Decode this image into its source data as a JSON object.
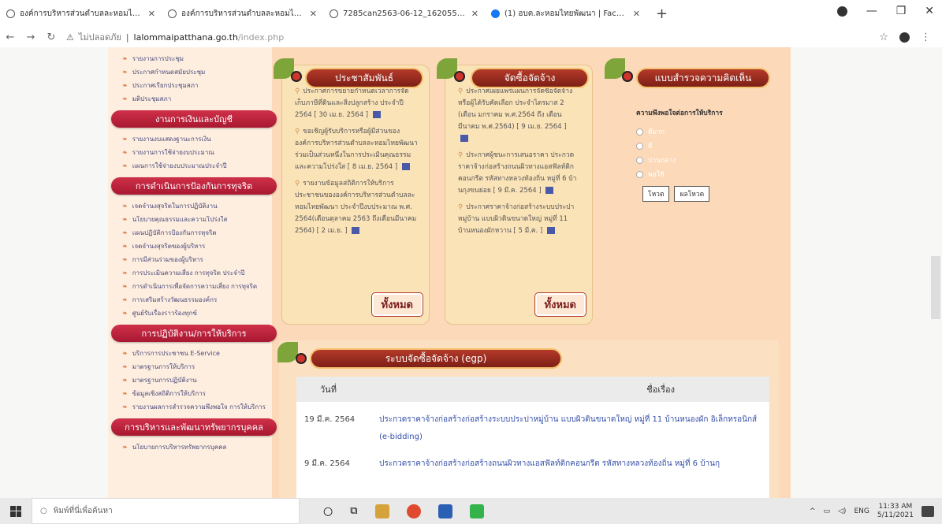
{
  "browser": {
    "tabs": [
      {
        "title": "องค์การบริหารส่วนตำบลละหอมไทยพัฒนา",
        "icon": "globe-icon"
      },
      {
        "title": "องค์การบริหารส่วนตำบลละหอมไทยพัฒนา",
        "icon": "globe-icon"
      },
      {
        "title": "7285can2563-06-12_162055pk",
        "icon": "globe-icon"
      },
      {
        "title": "(1) อบต.ละหอมไทยพัฒนา | Facebook",
        "icon": "facebook-icon"
      }
    ],
    "new_tab": "+",
    "url_secure_label": "ไม่ปลอดภัย",
    "url_domain": "lalommaipatthana.go.th",
    "url_path": "/index.php"
  },
  "sidebar": {
    "items_top": [
      "รายงานการประชุม",
      "ประกาศกำหนดสมัยประชุม",
      "ประกาศเรียกประชุมสภา",
      "มติประชุมสภา"
    ],
    "head_finance": "งานการเงินและบัญชี",
    "items_finance": [
      "รายงานงบแสดงฐานะการเงิน",
      "รายงานการใช้จ่ายงบประมาณ",
      "แผนการใช้จ่ายงบประมาณประจำปี"
    ],
    "head_corruption": "การดำเนินการป้องกันการทุจริต",
    "items_corruption": [
      "เจตจำนงสุจริตในการปฏิบัติงาน",
      "นโยบายคุณธรรมและความโปร่งใส",
      "แผนปฏิบัติการป้องกันการทุจริต",
      "เจตจำนงสุจริตของผู้บริหาร",
      "การมีส่วนร่วมของผู้บริหาร",
      "การประเมินความเสี่ยง การทุจริต ประจำปี",
      "การดำเนินการเพื่อจัดการความเสี่ยง การทุจริต",
      "การเสริมสร้างวัฒนธรรมองค์กร",
      "ศูนย์รับเรื่องราวร้องทุกข์"
    ],
    "head_service": "การปฏิบัติงาน/การให้บริการ",
    "items_service": [
      "บริการการประชาชน E-Service",
      "มาตรฐานการให้บริการ",
      "มาตรฐานการปฏิบัติงาน",
      "ข้อมูลเชิงสถิติการให้บริการ",
      "รายงานผลการสำรวจความพึงพอใจ การให้บริการ"
    ],
    "head_hr": "การบริหารและพัฒนาทรัพยากรบุคคล",
    "items_hr": [
      "นโยบายการบริหารทรัพยากรบุคคล"
    ]
  },
  "pr_box": {
    "title": "ประชาสัมพันธ์",
    "news": [
      "ประกาศการขยายกำหนดเวลาการจัดเก็บภาษีที่ดินและสิ่งปลูกสร้าง ประจำปี 2564 [ 30 เม.ย. 2564 ]",
      "ขอเชิญผู้รับบริการหรือผู้มีส่วนของ องค์การบริหารส่วนตำบลละหอมไทยพัฒนา ร่วมเป็นส่วนหนึ่งในการประเมินคุณธรรมและความโปร่งใส [ 8 เม.ย. 2564 ]",
      "รายงานข้อมูลสถิติการให้บริการประชาชนขององค์การบริหารส่วนตำบลละหอมไทยพัฒนา ประจำปีงบประมาณ พ.ศ. 2564(เดือนตุลาคม 2563 ถึงเดือนมีนาคม 2564) [ 2 เม.ย. ]"
    ],
    "all_label": "ทั้งหมด"
  },
  "procure_box": {
    "title": "จัดซื้อจัดจ้าง",
    "news": [
      "ประกาศเผยแพร่แผนการจัดซื้อจัดจ้างหรือผู้ได้รับคัดเลือก ประจำไตรมาส 2 (เดือน มกราคม พ.ศ.2564 ถึง เดือนมีนาคม พ.ศ.2564) [ 9 เม.ย. 2564 ]",
      "ประกาศผู้ชนะการเสนอราคา ประกวดราคาจ้างก่อสร้างถนนผิวทางแอสฟัลท์ติกคอนกรีต รหัสทางหลวงท้องถิ่น หมู่ที่ 6 บ้านกุงขนย่อย [ 9 มี.ค. 2564 ]",
      "ประกาศราคาจ้างก่อสร้างระบบประปาหมู่บ้าน แบบผิวดินขนาดใหญ่ หมู่ที่ 11 บ้านหนองผักหวาน [ 5 มี.ค. ]"
    ],
    "all_label": "ทั้งหมด"
  },
  "survey": {
    "title": "แบบสำรวจความคิดเห็น",
    "question": "ความพึงพอใจต่อการให้บริการ",
    "options": [
      "ดีมาก",
      "ดี",
      "ปานกลาง",
      "พอใช้"
    ],
    "vote_label": "โหวต",
    "result_label": "ผลโหวต"
  },
  "egp": {
    "title": "ระบบจัดซื้อจัดจ้าง (egp)",
    "col_date": "วันที่",
    "col_title": "ชื่อเรื่อง",
    "rows": [
      {
        "date": "19  มี.ค. 2564",
        "title": "ประกวดราคาจ้างก่อสร้างก่อสร้างระบบประปาหมู่บ้าน แบบผิวดินขนาดใหญ่ หมู่ที่ 11 บ้านหนองผัก อิเล็กทรอนิกส์ (e-bidding)"
      },
      {
        "date": "9  มี.ค. 2564",
        "title": "ประกวดราคาจ้างก่อสร้างก่อสร้างถนนผิวทางแอสฟัลท์ติกคอนกรีต รหัสทางหลวงท้องถิ่น หมู่ที่ 6 บ้านกุ"
      }
    ]
  },
  "taskbar": {
    "search_placeholder": "พิมพ์ที่นี่เพื่อค้นหา",
    "lang": "ENG",
    "time": "11:33 AM",
    "date": "5/11/2021"
  }
}
